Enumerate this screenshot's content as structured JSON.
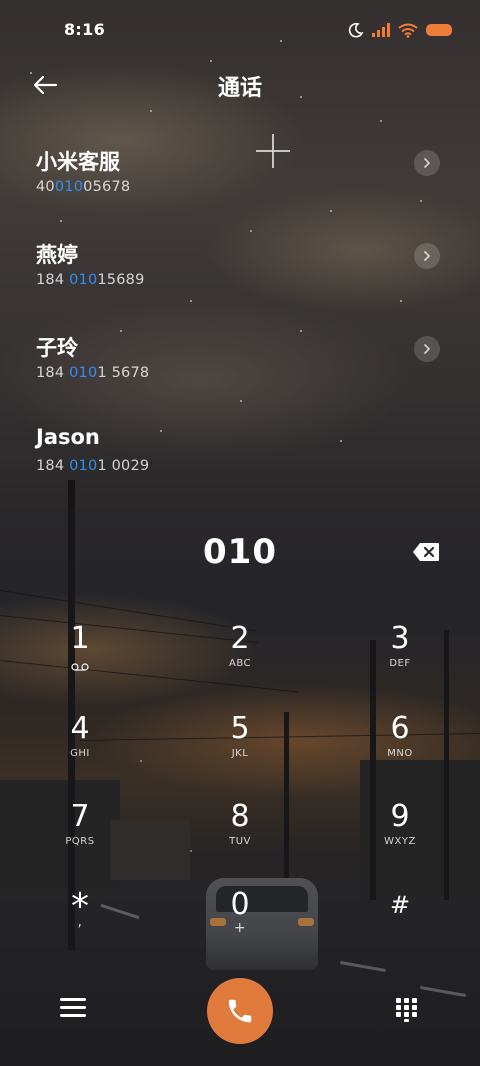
{
  "status_bar": {
    "time": "8:16",
    "icons": [
      "moon-icon",
      "signal-icon",
      "wifi-icon",
      "battery-icon"
    ],
    "battery_color": "#f07c3a"
  },
  "header": {
    "title": "通话",
    "back_icon": "arrow-left-icon"
  },
  "contacts": [
    {
      "name": "小米客服",
      "number_parts": [
        "40",
        "010",
        "05678"
      ]
    },
    {
      "name": "燕婷",
      "number_parts": [
        "184 ",
        "010",
        "15689"
      ]
    },
    {
      "name": "子玲",
      "number_parts": [
        "184 ",
        "010",
        "1 5678"
      ]
    },
    {
      "name": "Jason",
      "number_parts": [
        "184 ",
        "010",
        "1 0029"
      ]
    }
  ],
  "highlight_color": "#2f8ff0",
  "dialer": {
    "input": "010",
    "keys": [
      {
        "digit": "1",
        "letters": ""
      },
      {
        "digit": "2",
        "letters": "ABC"
      },
      {
        "digit": "3",
        "letters": "DEF"
      },
      {
        "digit": "4",
        "letters": "GHI"
      },
      {
        "digit": "5",
        "letters": "JKL"
      },
      {
        "digit": "6",
        "letters": "MNO"
      },
      {
        "digit": "7",
        "letters": "PQRS"
      },
      {
        "digit": "8",
        "letters": "TUV"
      },
      {
        "digit": "9",
        "letters": "WXYZ"
      },
      {
        "digit": "*",
        "letters": ","
      },
      {
        "digit": "0",
        "letters": "+"
      },
      {
        "digit": "#",
        "letters": ""
      }
    ]
  },
  "actions": {
    "call_color": "#e07a3d",
    "icons": [
      "menu-icon",
      "phone-icon",
      "keypad-icon"
    ]
  }
}
